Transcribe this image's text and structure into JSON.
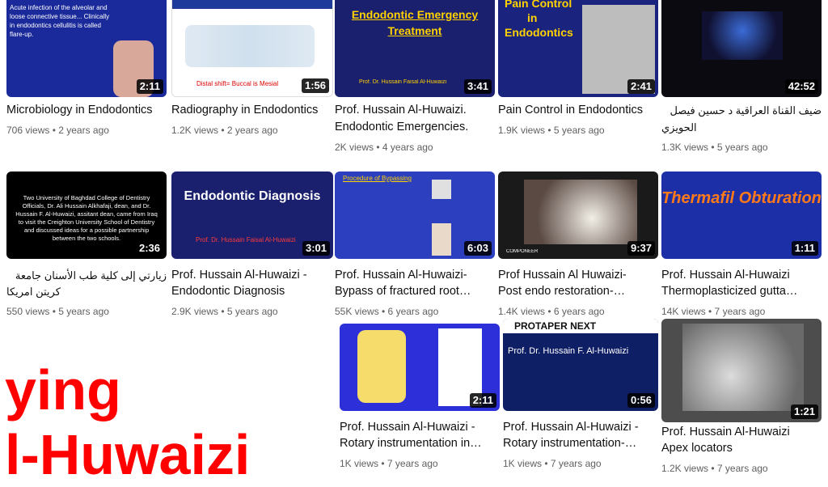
{
  "videos": [
    {
      "title": "Microbiology in Endodontics",
      "meta": "706 views • 2 years ago",
      "duration": "2:11",
      "thumb_caption": "Acute infection of the alveolar and loose connective tissue... Clinically in endodontics cellulitis is called flare-up."
    },
    {
      "title": "Radiography in Endodontics",
      "meta": "1.2K views • 2 years ago",
      "duration": "1:56",
      "thumb_caption": "Distal shift= Buccal is Mesial"
    },
    {
      "title_line1": "Prof. Hussain Al-Huwaizi.",
      "title_line2": "Endodontic Emergencies.",
      "meta": "2K views • 4 years ago",
      "duration": "3:41",
      "thumb_caption_1": "Endodontic Emergency",
      "thumb_caption_2": "Treatment",
      "thumb_caption_3": "Prof. Dr. Hussain Faisal Al-Huwaizi"
    },
    {
      "title": "Pain Control in Endodontics",
      "meta": "1.9K views • 5 years ago",
      "duration": "2:41",
      "thumb_caption_1": "Pain Control",
      "thumb_caption_2": "in",
      "thumb_caption_3": "Endodontics"
    },
    {
      "title_line1": "ضيف القناة العراقية د حسين فيصل",
      "title_line2": "الحويزي",
      "meta": "1.3K views • 5 years ago",
      "duration": "42:52"
    },
    {
      "title_line1": "زيارتي إلى كلية طب الأسنان جامعة",
      "title_line2": "كريتن امريكا",
      "meta": "550 views • 5 years ago",
      "duration": "2:36",
      "thumb_caption": "Two University of Baghdad College of Dentistry Officials, Dr. Ali Hussain Alkhafaji, dean, and Dr. Hussain F. Al-Huwaizi, assitant dean, came from Iraq to visit the Creighton University School of Dentistry and discussed ideas for a possible partnership between the two schools."
    },
    {
      "title_line1": "Prof. Hussain Al-Huwaizi -",
      "title_line2": "Endodontic Diagnosis",
      "meta": "2.9K views • 5 years ago",
      "duration": "3:01",
      "thumb_caption_1": "Endodontic Diagnosis",
      "thumb_caption_2": "Prof. Dr. Hussain Faisal Al-Huwaizi"
    },
    {
      "title_line1": "Prof. Hussain Al-Huwaizi-",
      "title_line2": "Bypass of fractured root…",
      "meta": "55K views • 6 years ago",
      "duration": "6:03",
      "thumb_caption": "Procedure of Bypassing"
    },
    {
      "title_line1": "Prof Hussain Al Huwaizi-",
      "title_line2": "Post endo restoration-…",
      "meta": "1.4K views • 6 years ago",
      "duration": "9:37",
      "thumb_caption": "COMPONEER"
    },
    {
      "title_line1": "Prof. Hussain Al-Huwaizi",
      "title_line2": "Thermoplasticized gutta…",
      "meta": "14K views • 7 years ago",
      "duration": "1:11",
      "thumb_caption": "Thermafil Obturation"
    },
    {
      "title_line1": "Prof. Hussain Al-Huwaizi -",
      "title_line2": "Rotary instrumentation in…",
      "meta": "1K views • 7 years ago",
      "duration": "2:11"
    },
    {
      "title_line1": "Prof. Hussain Al-Huwaizi -",
      "title_line2": "Rotary instrumentation-…",
      "meta": "1K views • 7 years ago",
      "duration": "0:56",
      "thumb_caption_1": "PROTAPER NEXT",
      "thumb_caption_2": "Prof. Dr. Hussain F. Al-Huwaizi"
    },
    {
      "title_line1": "Prof. Hussain Al-Huwaizi",
      "title_line2": "Apex locators",
      "meta": "1.2K views • 7 years ago",
      "duration": "1:21"
    }
  ],
  "overlay": {
    "line1": "ying",
    "line2": "l-Huwaizi",
    "color": "#ff0000"
  }
}
